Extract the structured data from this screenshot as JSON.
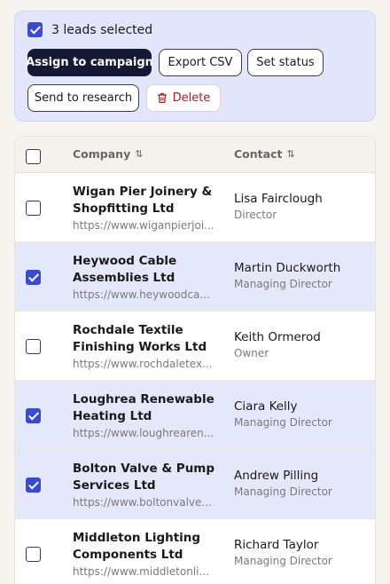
{
  "bulk": {
    "selected_label": "3 leads selected",
    "assign_label": "Assign to campaign",
    "export_label": "Export CSV",
    "status_label": "Set status",
    "research_label": "Send to research",
    "delete_label": "Delete"
  },
  "table": {
    "col_company": "Company",
    "col_contact": "Contact",
    "sort_glyph": "⇅",
    "rows": [
      {
        "company_line1": "Wigan Pier Joinery &",
        "company_line2": "Shopfitting Ltd",
        "url": "https://www.wiganpierjoi...",
        "contact": "Lisa Fairclough",
        "role": "Director",
        "checked": false
      },
      {
        "company_line1": "Heywood Cable",
        "company_line2": "Assemblies Ltd",
        "url": "https://www.heywoodca...",
        "contact": "Martin Duckworth",
        "role": "Managing Director",
        "checked": true
      },
      {
        "company_line1": "Rochdale Textile",
        "company_line2": "Finishing Works Ltd",
        "url": "https://www.rochdaletex...",
        "contact": "Keith Ormerod",
        "role": "Owner",
        "checked": false
      },
      {
        "company_line1": "Loughrea Renewable",
        "company_line2": "Heating Ltd",
        "url": "https://www.loughrearen...",
        "contact": "Ciara Kelly",
        "role": "Managing Director",
        "checked": true
      },
      {
        "company_line1": "Bolton Valve & Pump",
        "company_line2": "Services Ltd",
        "url": "https://www.boltonvalve...",
        "contact": "Andrew Pilling",
        "role": "Managing Director",
        "checked": true
      },
      {
        "company_line1": "Middleton Lighting",
        "company_line2": "Components Ltd",
        "url": "https://www.middletonli...",
        "contact": "Richard Taylor",
        "role": "Managing Director",
        "checked": false
      }
    ]
  },
  "colors": {
    "accent": "#3a4bd1",
    "bulk_bg": "#e3e6fb",
    "primary_btn": "#141a33",
    "danger": "#a32121"
  }
}
